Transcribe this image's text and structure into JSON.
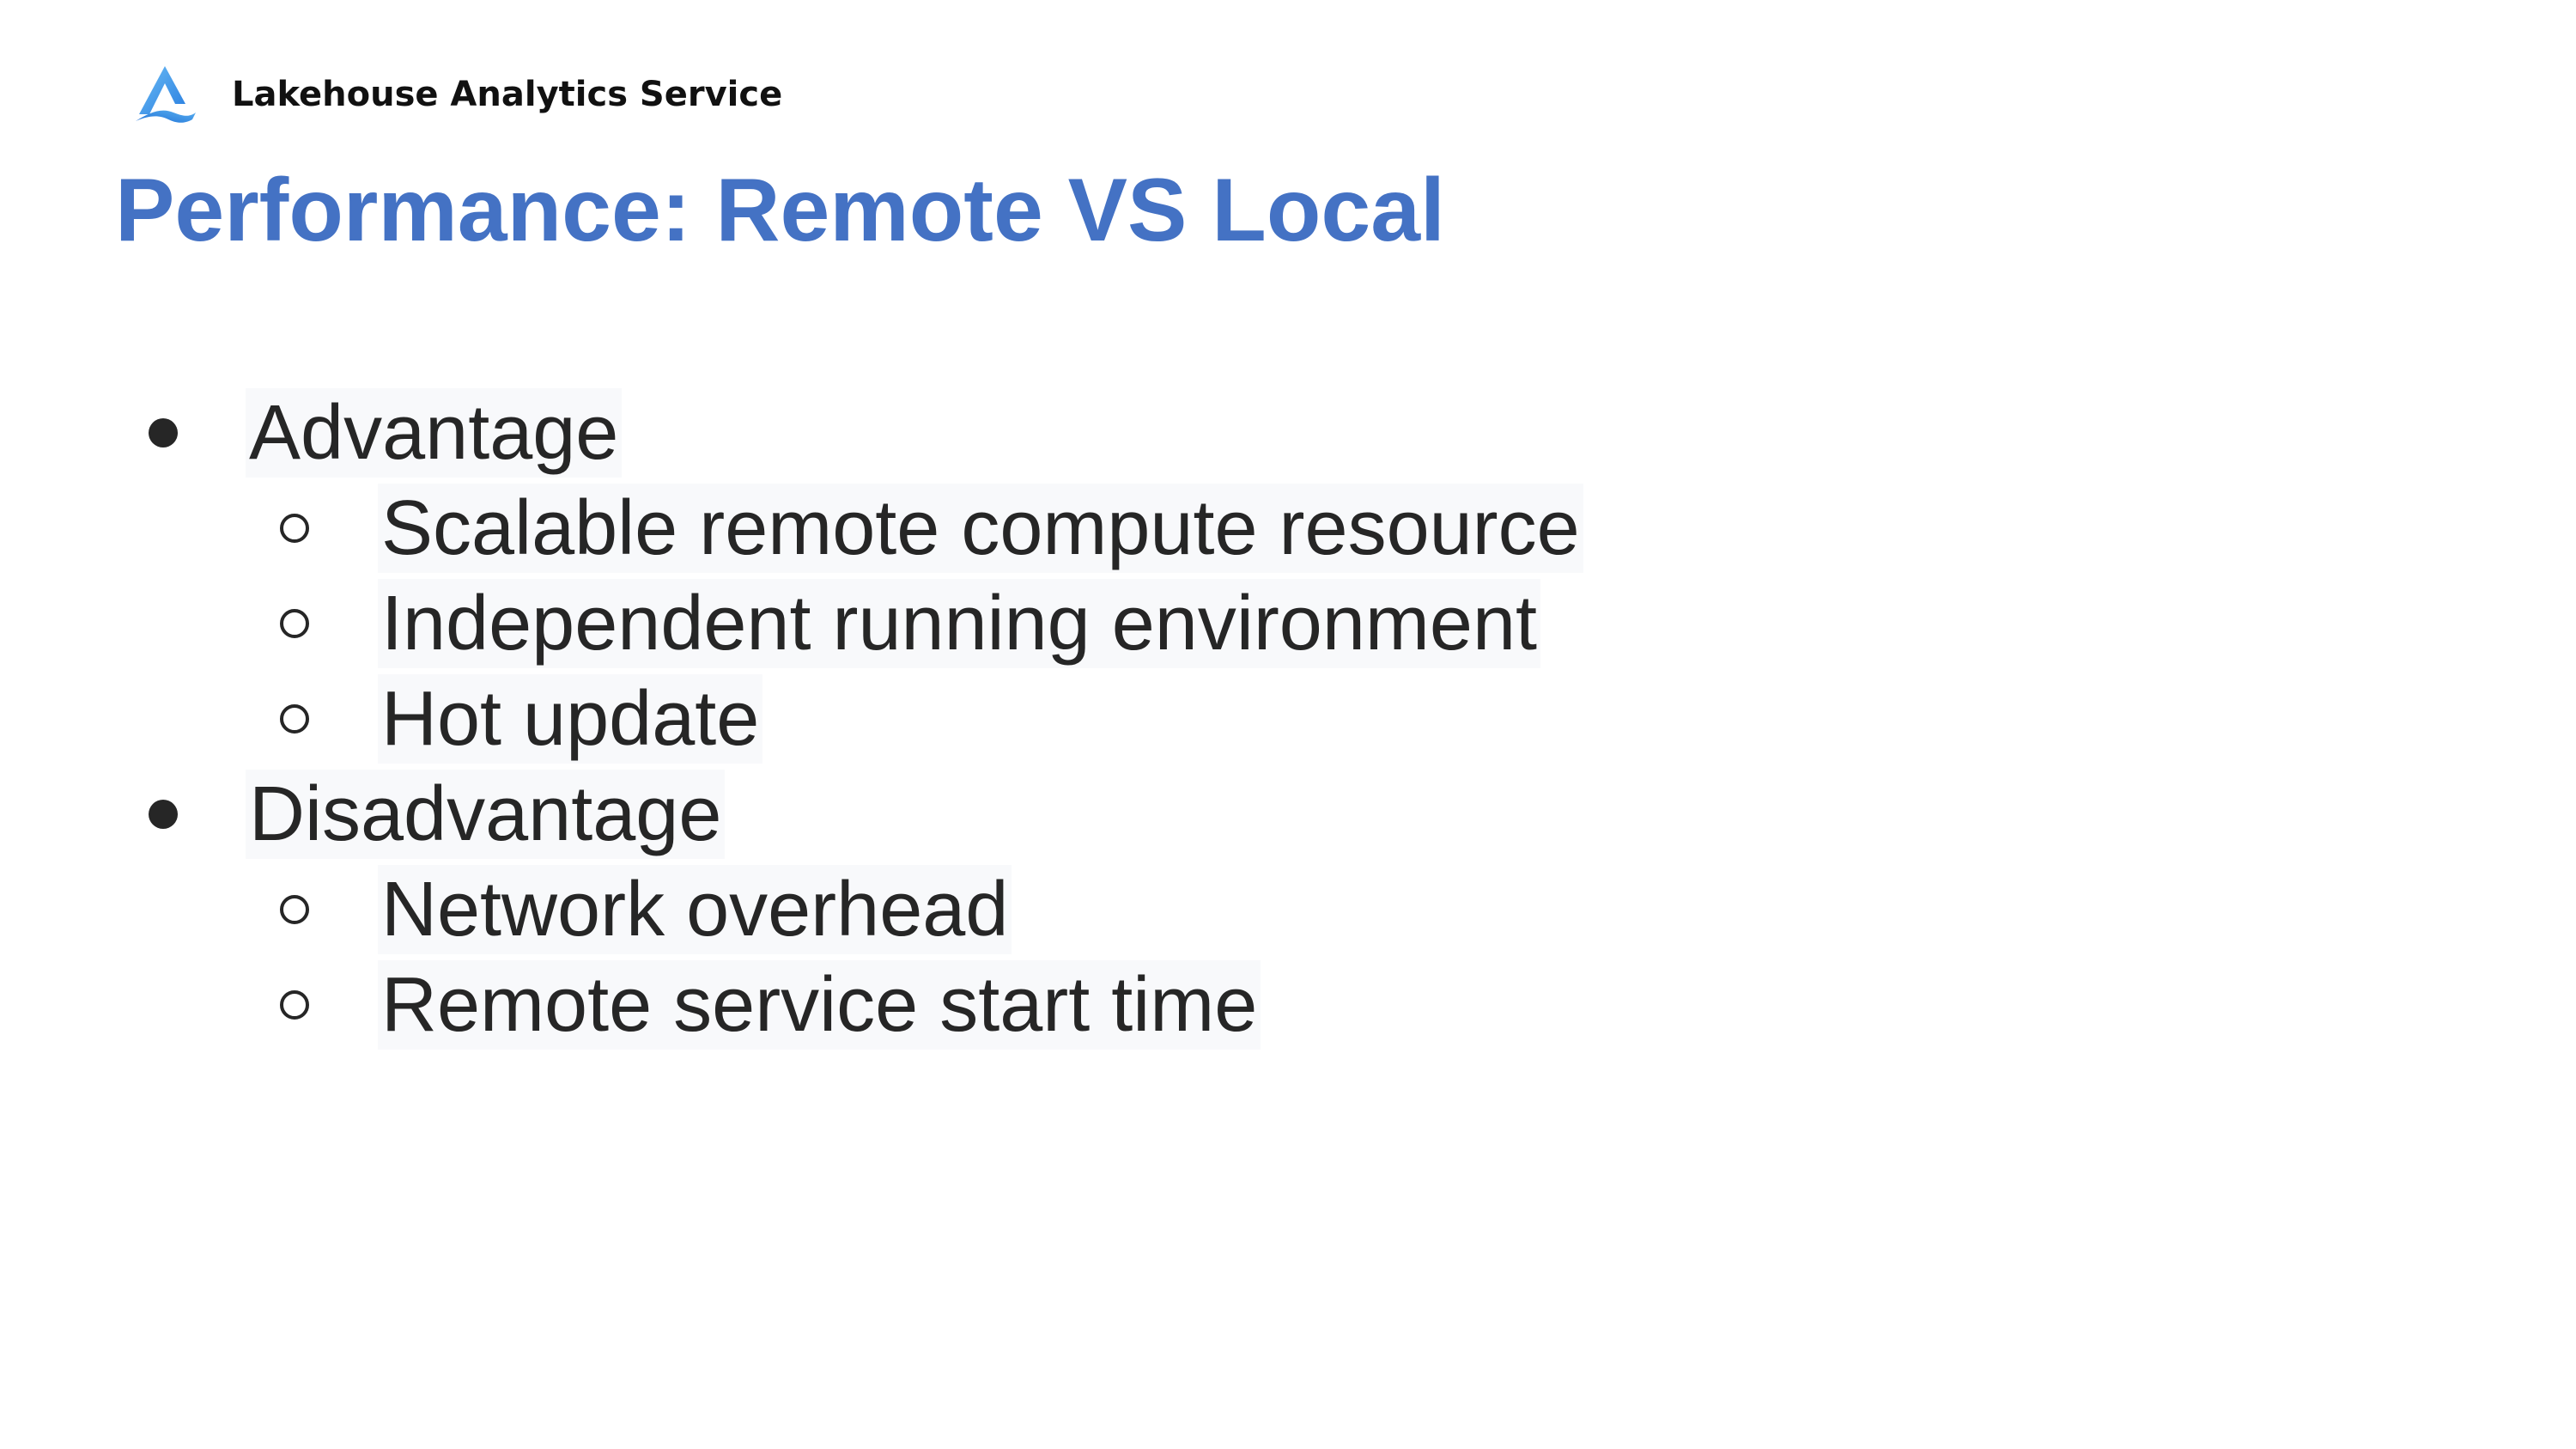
{
  "header": {
    "brand_name": "Lakehouse Analytics Service",
    "logo_icon": "triangle-a-logo-icon",
    "logo_colors": [
      "#2a7fe0",
      "#6bbcf5"
    ]
  },
  "slide": {
    "title": "Performance: Remote VS Local",
    "title_color": "#4472c4"
  },
  "bullets": [
    {
      "level": 1,
      "marker": "filled-circle",
      "text": "Advantage"
    },
    {
      "level": 2,
      "marker": "hollow-circle",
      "text": "Scalable remote compute resource"
    },
    {
      "level": 2,
      "marker": "hollow-circle",
      "text": "Independent running environment"
    },
    {
      "level": 2,
      "marker": "hollow-circle",
      "text": "Hot update"
    },
    {
      "level": 1,
      "marker": "filled-circle",
      "text": "Disadvantage"
    },
    {
      "level": 2,
      "marker": "hollow-circle",
      "text": "Network overhead"
    },
    {
      "level": 2,
      "marker": "hollow-circle",
      "text": "Remote service start time"
    }
  ]
}
